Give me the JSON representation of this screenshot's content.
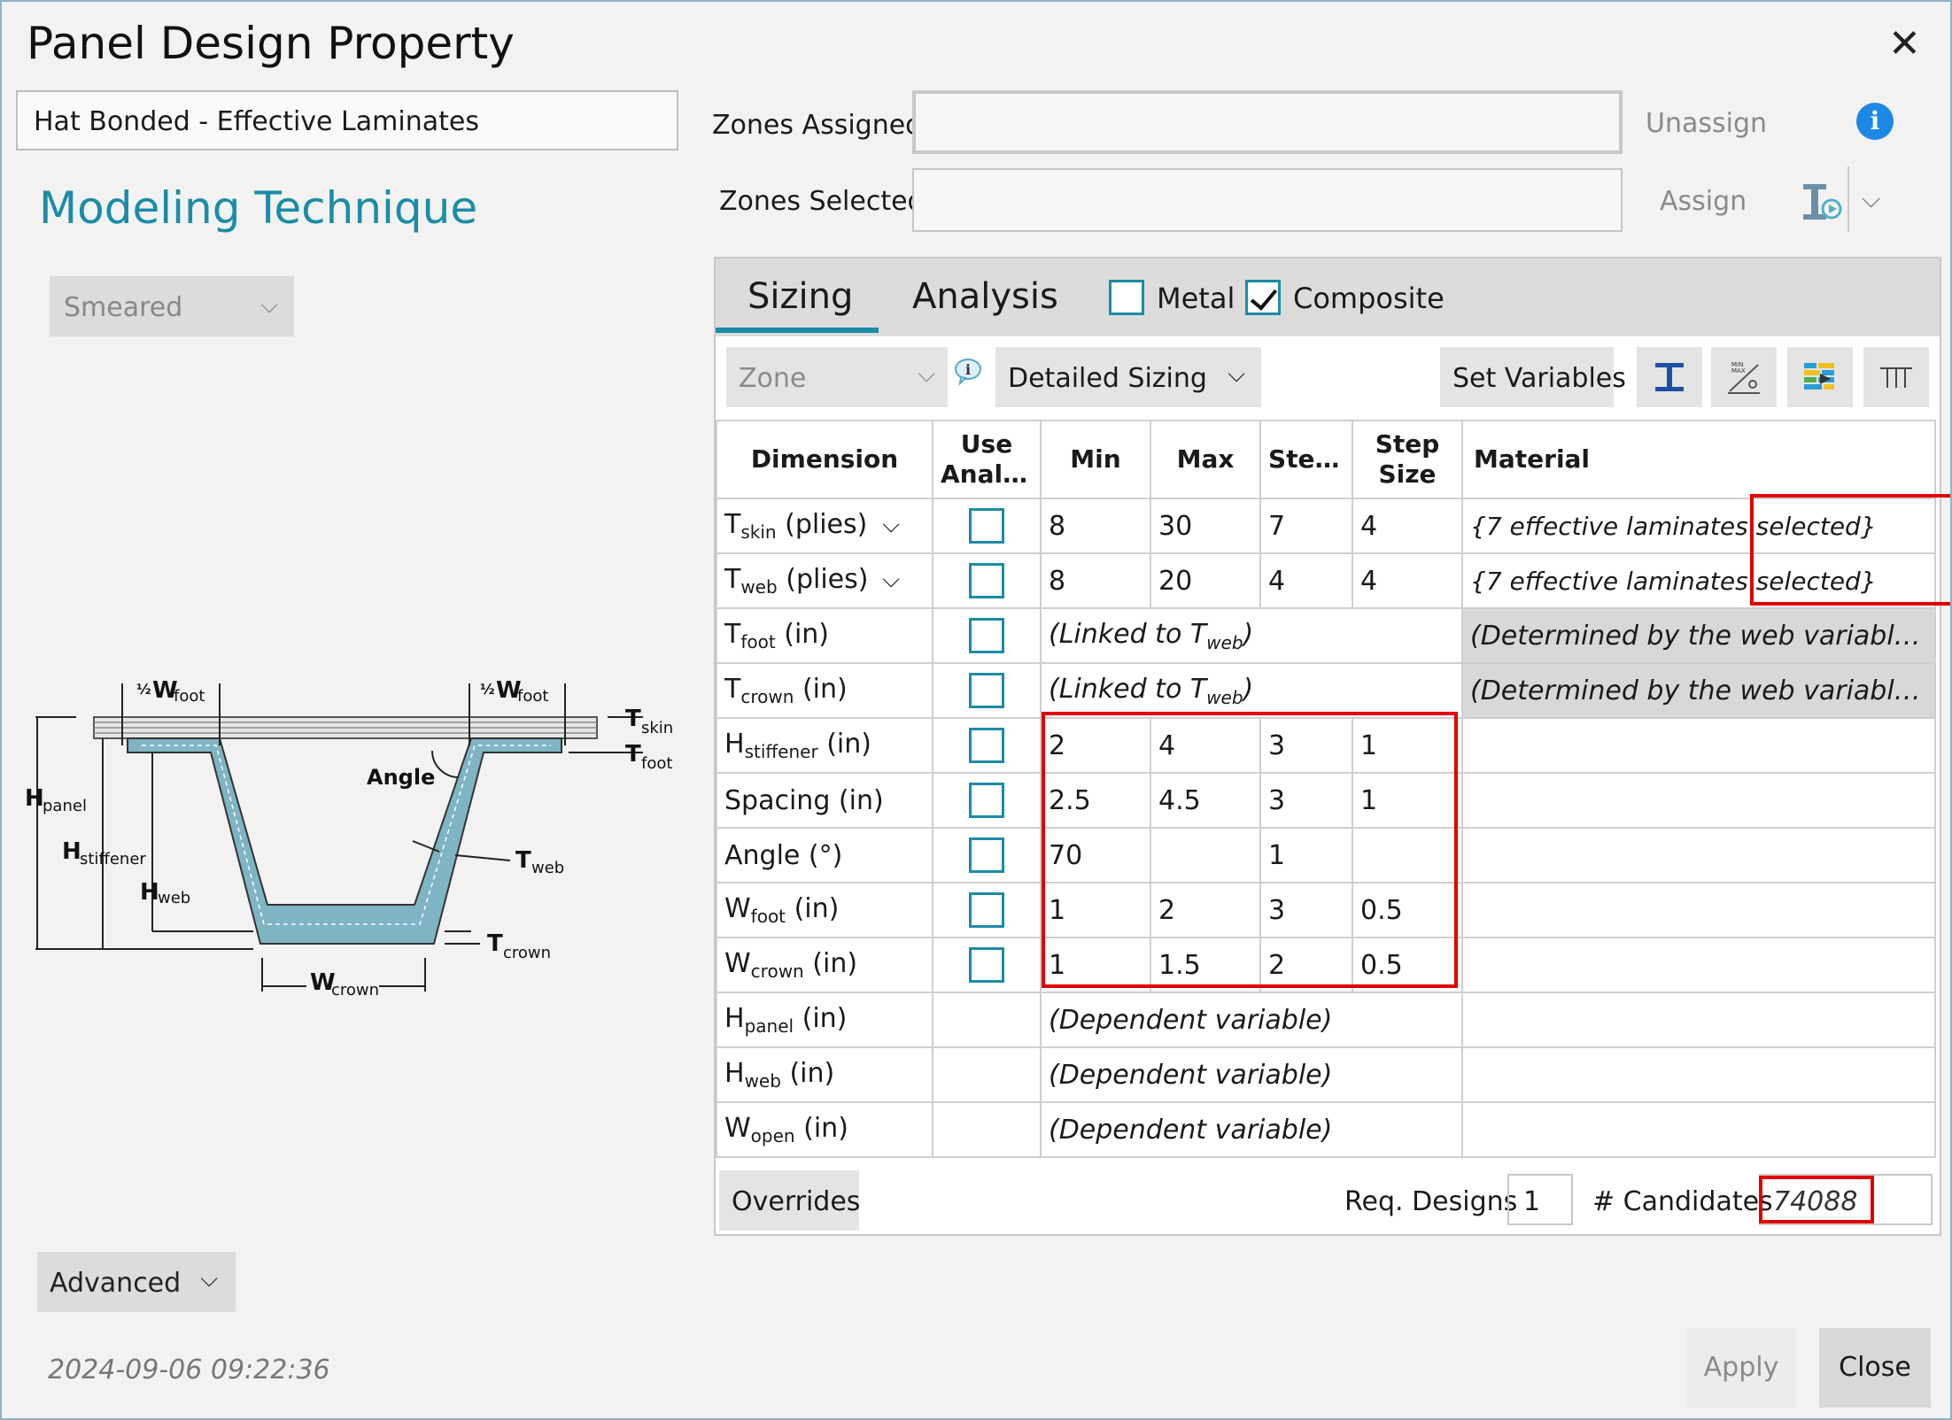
{
  "window": {
    "title": "Panel Design Property",
    "close_glyph": "✕"
  },
  "left": {
    "panel_name": "Hat Bonded - Effective Laminates",
    "section_title": "Modeling Technique",
    "technique": "Smeared",
    "advanced_label": "Advanced",
    "timestamp": "2024-09-06 09:22:36",
    "diagram": {
      "half_wfoot_left": "½",
      "wfoot": "W",
      "foot": "foot",
      "t": "T",
      "skin": "skin",
      "angle": "Angle",
      "h": "H",
      "panel": "panel",
      "stiffener": "stiffener",
      "web": "web",
      "crown": "crown"
    }
  },
  "zones": {
    "assigned_label": "Zones Assigned:",
    "assigned_value": "",
    "unassign_label": "Unassign",
    "info_icon": "i",
    "selected_label": "Zones Selected:",
    "selected_value": "",
    "assign_label": "Assign"
  },
  "tabs": {
    "sizing": "Sizing",
    "analysis": "Analysis",
    "metal_label": "Metal",
    "metal_checked": false,
    "composite_label": "Composite",
    "composite_checked": true
  },
  "toolbar": {
    "zone_placeholder": "Zone",
    "sizing_mode": "Detailed Sizing",
    "set_variables": "Set Variables"
  },
  "table": {
    "headers": {
      "dimension": "Dimension",
      "use": "Use",
      "analysis": "Analysis",
      "min": "Min",
      "max": "Max",
      "steps": "Steps",
      "step": "Step",
      "size": "Size",
      "material": "Material"
    },
    "rows": [
      {
        "base": "T",
        "sub": "skin",
        "unit": "(plies)",
        "min": "8",
        "max": "30",
        "steps": "7",
        "step_size": "4",
        "material": "{7 effective laminates selected}"
      },
      {
        "base": "T",
        "sub": "web",
        "unit": "(plies)",
        "min": "8",
        "max": "20",
        "steps": "4",
        "step_size": "4",
        "material": "{7 effective laminates selected}"
      },
      {
        "base": "T",
        "sub": "foot",
        "unit": "(in)",
        "linked_text": "(Linked to T",
        "linked_sub": "web",
        "linked_close": ")",
        "material": "(Determined by the web variable's mater..."
      },
      {
        "base": "T",
        "sub": "crown",
        "unit": "(in)",
        "linked_text": "(Linked to T",
        "linked_sub": "web",
        "linked_close": ")",
        "material": "(Determined by the web variable's mater..."
      },
      {
        "base": "H",
        "sub": "stiffener",
        "unit": "(in)",
        "min": "2",
        "max": "4",
        "steps": "3",
        "step_size": "1"
      },
      {
        "base": "Spacing",
        "sub": "",
        "unit": "(in)",
        "min": "2.5",
        "max": "4.5",
        "steps": "3",
        "step_size": "1"
      },
      {
        "base": "Angle",
        "sub": "",
        "unit": "(°)",
        "min": "70",
        "max": "",
        "steps": "1",
        "step_size": ""
      },
      {
        "base": "W",
        "sub": "foot",
        "unit": "(in)",
        "min": "1",
        "max": "2",
        "steps": "3",
        "step_size": "0.5"
      },
      {
        "base": "W",
        "sub": "crown",
        "unit": "(in)",
        "min": "1",
        "max": "1.5",
        "steps": "2",
        "step_size": "0.5"
      },
      {
        "base": "H",
        "sub": "panel",
        "unit": "(in)",
        "dependent": "(Dependent variable)"
      },
      {
        "base": "H",
        "sub": "web",
        "unit": "(in)",
        "dependent": "(Dependent variable)"
      },
      {
        "base": "W",
        "sub": "open",
        "unit": "(in)",
        "dependent": "(Dependent variable)"
      }
    ]
  },
  "footer": {
    "overrides_label": "Overrides",
    "req_designs_label": "Req. Designs",
    "req_designs_value": "1",
    "candidates_label": "# Candidates",
    "candidates_value": "74088"
  },
  "buttons": {
    "apply": "Apply",
    "close": "Close"
  },
  "colors": {
    "accent": "#1b8ca6",
    "highlight": "#e00000",
    "info": "#1e88e5"
  }
}
